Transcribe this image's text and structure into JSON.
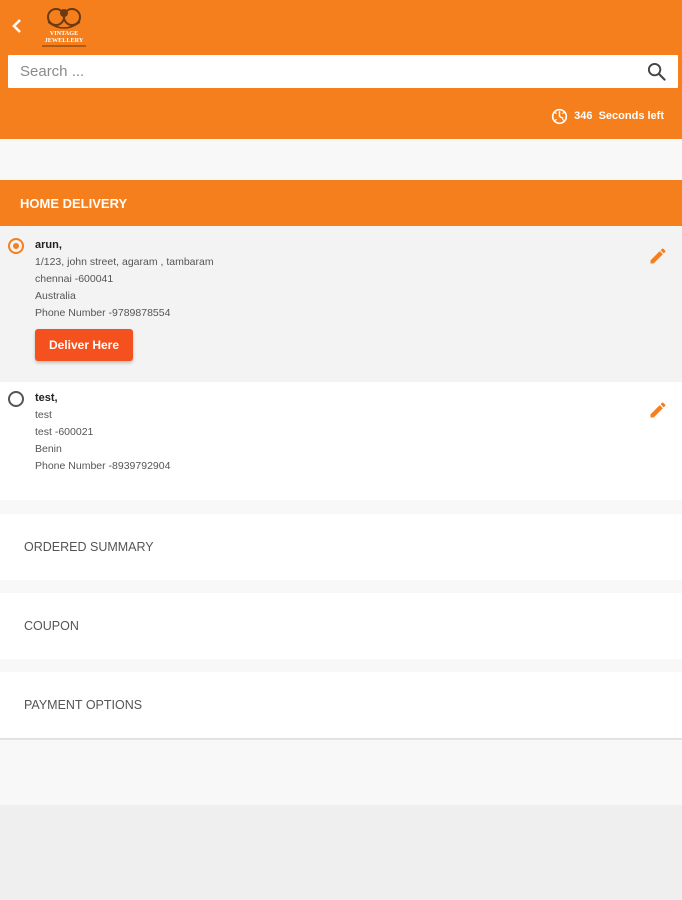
{
  "header": {
    "logo_text": [
      "VINTAGE",
      "JEWELLERY"
    ],
    "brand_color": "#f47f1c",
    "back_icon": "chevron-left-icon"
  },
  "search": {
    "placeholder": "Search ...",
    "value": "",
    "icon": "search-icon"
  },
  "timer": {
    "seconds": 346,
    "text": "346  Seconds left",
    "icon": "timer-icon"
  },
  "home_delivery": {
    "title": "HOME DELIVERY",
    "addresses": [
      {
        "selected": true,
        "name": "arun,",
        "street": "1/123, john street, agaram , tambaram",
        "city": "chennai -600041",
        "country": "Australia",
        "phone": "Phone Number -9789878554",
        "deliver_label": "Deliver Here"
      },
      {
        "selected": false,
        "name": "test,",
        "street": "test",
        "city": "test -600021",
        "country": "Benin",
        "phone": "Phone Number -8939792904"
      }
    ],
    "edit_icon": "pencil-icon",
    "button_color": "#f4511e"
  },
  "sections": {
    "ordered_summary": "ORDERED SUMMARY",
    "coupon": "COUPON",
    "payment_options": "PAYMENT OPTIONS"
  }
}
